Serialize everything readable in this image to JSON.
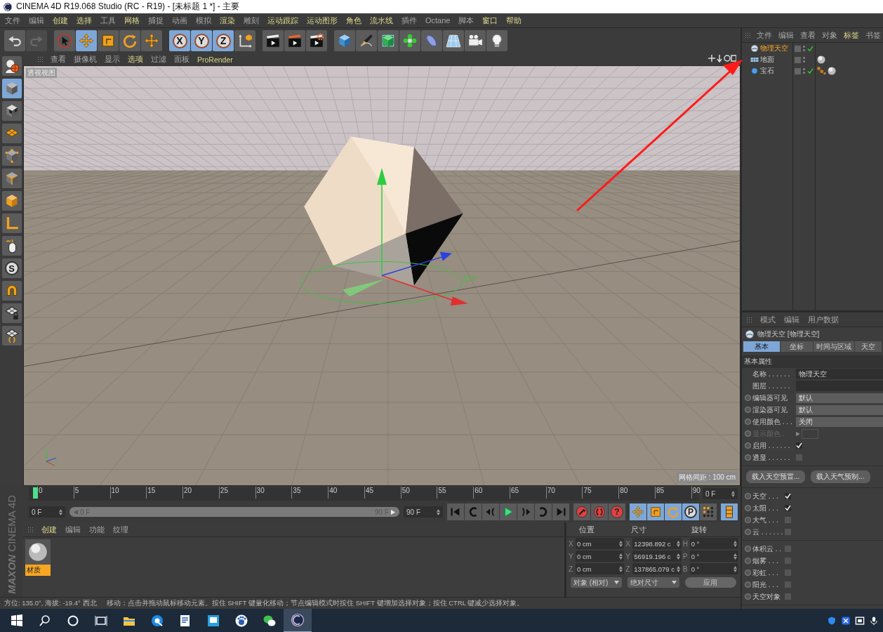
{
  "window": {
    "title": "CINEMA 4D R19.068 Studio (RC - R19) - [未标题 1 *] - 主要"
  },
  "menu_bar": [
    {
      "label": "文件",
      "highlighted": false
    },
    {
      "label": "编辑",
      "highlighted": false
    },
    {
      "label": "创建",
      "highlighted": true
    },
    {
      "label": "选择",
      "highlighted": true
    },
    {
      "label": "工具",
      "highlighted": false
    },
    {
      "label": "网格",
      "highlighted": true
    },
    {
      "label": "捕捉",
      "highlighted": false
    },
    {
      "label": "动画",
      "highlighted": false
    },
    {
      "label": "模拟",
      "highlighted": false
    },
    {
      "label": "渲染",
      "highlighted": true
    },
    {
      "label": "雕刻",
      "highlighted": false
    },
    {
      "label": "运动跟踪",
      "highlighted": true
    },
    {
      "label": "运动图形",
      "highlighted": true
    },
    {
      "label": "角色",
      "highlighted": true
    },
    {
      "label": "流水线",
      "highlighted": true
    },
    {
      "label": "插件",
      "highlighted": false
    },
    {
      "label": "Octane",
      "highlighted": false
    },
    {
      "label": "脚本",
      "highlighted": false
    },
    {
      "label": "窗口",
      "highlighted": true
    },
    {
      "label": "帮助",
      "highlighted": true
    }
  ],
  "toolbar_groups": [
    {
      "buttons": [
        {
          "kind": "undo",
          "active": false,
          "disabled": false
        },
        {
          "kind": "redo",
          "active": false,
          "disabled": true
        }
      ]
    },
    {
      "buttons": [
        {
          "kind": "select",
          "active": false,
          "disabled": false
        },
        {
          "kind": "move",
          "active": true,
          "disabled": false
        },
        {
          "kind": "scale",
          "active": false,
          "disabled": false
        },
        {
          "kind": "rotate",
          "active": false,
          "disabled": false
        },
        {
          "kind": "move",
          "active": false,
          "disabled": false
        }
      ]
    },
    {
      "buttons": [
        {
          "kind": "axis",
          "label": "X",
          "active": true,
          "disabled": false
        },
        {
          "kind": "axis",
          "label": "Y",
          "active": true,
          "disabled": false
        },
        {
          "kind": "axis",
          "label": "Z",
          "active": true,
          "disabled": false
        },
        {
          "kind": "coord",
          "active": false,
          "disabled": false
        }
      ]
    },
    {
      "buttons": [
        {
          "kind": "render_view",
          "active": false,
          "disabled": false
        },
        {
          "kind": "render_picture",
          "active": false,
          "disabled": false
        },
        {
          "kind": "render_settings",
          "active": false,
          "disabled": false
        }
      ]
    },
    {
      "buttons": [
        {
          "kind": "cube",
          "active": false,
          "disabled": false
        },
        {
          "kind": "pen",
          "active": false,
          "disabled": false
        },
        {
          "kind": "subdiv",
          "active": false,
          "disabled": false
        },
        {
          "kind": "cloner",
          "active": false,
          "disabled": false
        },
        {
          "kind": "deformer",
          "active": false,
          "disabled": false
        },
        {
          "kind": "floor",
          "active": false,
          "disabled": false
        },
        {
          "kind": "camera",
          "active": false,
          "disabled": false
        },
        {
          "kind": "light",
          "active": false,
          "disabled": false
        }
      ]
    }
  ],
  "left_toolbar": [
    {
      "kind": "globe",
      "active": false
    },
    {
      "kind": "model",
      "active": true
    },
    {
      "kind": "texture",
      "active": false
    },
    {
      "kind": "workplane",
      "active": false
    },
    {
      "kind": "points",
      "active": false
    },
    {
      "kind": "edges",
      "active": false
    },
    {
      "kind": "polygons",
      "active": false
    },
    {
      "kind": "axis_mode",
      "active": false
    },
    {
      "kind": "tweak",
      "active": false
    },
    {
      "kind": "snap",
      "label": "S",
      "active": false
    },
    {
      "kind": "magnet",
      "active": false
    },
    {
      "kind": "grid_lock",
      "active": false
    },
    {
      "kind": "grid_snap",
      "active": false
    }
  ],
  "viewport": {
    "menu": [
      {
        "label": "查看",
        "highlighted": false
      },
      {
        "label": "摄像机",
        "highlighted": false
      },
      {
        "label": "显示",
        "highlighted": false
      },
      {
        "label": "选项",
        "highlighted": true
      },
      {
        "label": "过滤",
        "highlighted": false
      },
      {
        "label": "面板",
        "highlighted": false
      },
      {
        "label": "ProRender",
        "highlighted": true
      }
    ],
    "view_label": "透视视图",
    "grid_spacing": "网格间距 : 100 cm"
  },
  "object_manager": {
    "menu": [
      {
        "label": "文件",
        "highlighted": false
      },
      {
        "label": "编辑",
        "highlighted": false
      },
      {
        "label": "查看",
        "highlighted": false
      },
      {
        "label": "对象",
        "highlighted": false
      },
      {
        "label": "标签",
        "highlighted": true
      },
      {
        "label": "书签",
        "highlighted": false
      }
    ],
    "objects": [
      {
        "name": "物理天空",
        "kind": "sky",
        "selected": true,
        "checked": true
      },
      {
        "name": "地面",
        "kind": "floor",
        "selected": false,
        "checked": false,
        "tags": [
          {
            "kind": "material"
          }
        ]
      },
      {
        "name": "宝石",
        "kind": "gem",
        "selected": false,
        "checked": true,
        "tags": [
          {
            "kind": "dots"
          },
          {
            "kind": "material"
          }
        ]
      }
    ]
  },
  "attributes": {
    "menu": [
      "模式",
      "编辑",
      "用户数据"
    ],
    "title": "物理天空 [物理天空]",
    "tabs": [
      {
        "label": "基本",
        "selected": true
      },
      {
        "label": "坐标",
        "selected": false
      },
      {
        "label": "时间与区域",
        "selected": false
      },
      {
        "label": "天空",
        "selected": false
      }
    ],
    "section": "基本属性",
    "rows": [
      {
        "kind": "field",
        "label": "名称 . . . . . .",
        "value": "物理天空",
        "animatable": false,
        "disabled": false
      },
      {
        "kind": "field",
        "label": "图层 . . . . . .",
        "animatable": false,
        "disabled": false
      },
      {
        "kind": "dropdown",
        "label": "编辑器可见",
        "value": "默认",
        "animatable": true,
        "disabled": false
      },
      {
        "kind": "dropdown",
        "label": "渲染器可见",
        "value": "默认",
        "animatable": true,
        "disabled": false
      },
      {
        "kind": "dropdown",
        "label": "使用颜色 . . .",
        "value": "关闭",
        "animatable": true,
        "disabled": false
      },
      {
        "kind": "color",
        "label": "显示颜色 .",
        "animatable": true,
        "disabled": true
      },
      {
        "kind": "checkbox",
        "label": "启用 . . . . . .",
        "checked": true,
        "animatable": true,
        "disabled": false
      },
      {
        "kind": "checkbox",
        "label": "透显 . . . . . .",
        "checked": false,
        "animatable": true,
        "disabled": false
      }
    ],
    "buttons": [
      "载入天空预置...",
      "载入天气预制..."
    ],
    "toggle_groups": [
      [
        {
          "label": "天空 . . .",
          "checked": true
        },
        {
          "label": "太阳 . . .",
          "checked": true
        },
        {
          "label": "大气 . . .",
          "checked": false
        },
        {
          "label": "云 . . . . . .",
          "checked": false
        }
      ],
      [
        {
          "label": "体积云 . .",
          "checked": false
        },
        {
          "label": "烟雾 . . .",
          "checked": false
        },
        {
          "label": "彩虹 . . .",
          "checked": false
        },
        {
          "label": "阳光 . . .",
          "checked": false
        },
        {
          "label": "天空对象",
          "checked": false
        }
      ]
    ]
  },
  "timeline": {
    "ticks": [
      "0",
      "5",
      "10",
      "15",
      "20",
      "25",
      "30",
      "35",
      "40",
      "45",
      "50",
      "55",
      "60",
      "65",
      "70",
      "75",
      "80",
      "85",
      "90"
    ],
    "current_frame": "0 F",
    "start": "0 F",
    "range": {
      "start": "0 F",
      "end": "90 F",
      "level": 1
    },
    "end": "90 F",
    "transport": [
      {
        "kind": "first"
      },
      {
        "kind": "prev_key"
      },
      {
        "kind": "prev_frame"
      },
      {
        "kind": "play"
      },
      {
        "kind": "next_frame"
      },
      {
        "kind": "next_key"
      },
      {
        "kind": "last"
      }
    ],
    "record": [
      {
        "kind": "record"
      },
      {
        "kind": "auto_key"
      },
      {
        "kind": "key_help",
        "label": "?"
      }
    ],
    "keys": [
      {
        "kind": "move",
        "active": true
      },
      {
        "kind": "scale",
        "active": true
      },
      {
        "kind": "rotate",
        "active": true
      },
      {
        "kind": "param",
        "label": "P",
        "active": true
      },
      {
        "kind": "point_level",
        "active": false
      }
    ]
  },
  "logo": {
    "brand": "MAXON",
    "product": "CINEMA 4D"
  },
  "materials": {
    "menu": [
      {
        "label": "创建",
        "highlighted": true
      },
      {
        "label": "编辑",
        "highlighted": false
      },
      {
        "label": "功能",
        "highlighted": false
      },
      {
        "label": "纹理",
        "highlighted": false
      }
    ],
    "items": [
      {
        "name": "材质",
        "selected": true
      }
    ]
  },
  "coordinates": {
    "headers": [
      "位置",
      "尺寸",
      "旋转"
    ],
    "rows": [
      [
        {
          "axis": "X",
          "value": "0 cm"
        },
        {
          "axis": "X",
          "value": "12398.892 c"
        },
        {
          "axis": "H",
          "value": "0 °"
        }
      ],
      [
        {
          "axis": "Y",
          "value": "0 cm"
        },
        {
          "axis": "Y",
          "value": "56919.196 c"
        },
        {
          "axis": "P",
          "value": "0 °"
        }
      ],
      [
        {
          "axis": "Z",
          "value": "0 cm"
        },
        {
          "axis": "Z",
          "value": "137865.079 c"
        },
        {
          "axis": "B",
          "value": "0 °"
        }
      ]
    ],
    "mode": "对象 (相对)",
    "size_mode": "绝对尺寸",
    "apply": "应用"
  },
  "status_bar": {
    "orientation": "方位: 135.0°, 海拔: -19.4°  西北",
    "hint": "移动：点击并拖动鼠标移动元素。按住 SHIFT 键量化移动；节点编辑模式时按住 SHIFT 键增加选择对象；按住 CTRL 键减少选择对象。"
  },
  "taskbar": {
    "apps": [
      {
        "kind": "start",
        "active": false
      },
      {
        "kind": "search",
        "active": false
      },
      {
        "kind": "cortana",
        "active": false
      },
      {
        "kind": "task_view",
        "active": false
      },
      {
        "kind": "explorer",
        "active": false
      },
      {
        "kind": "browser",
        "active": false
      },
      {
        "kind": "editor",
        "active": false
      },
      {
        "kind": "viewer",
        "active": false
      },
      {
        "kind": "baidu",
        "active": false
      },
      {
        "kind": "wechat",
        "active": false
      },
      {
        "kind": "c4d",
        "active": true
      }
    ],
    "tray": [
      {
        "kind": "shield"
      },
      {
        "kind": "cross"
      },
      {
        "kind": "box"
      },
      {
        "kind": "mic"
      }
    ]
  }
}
